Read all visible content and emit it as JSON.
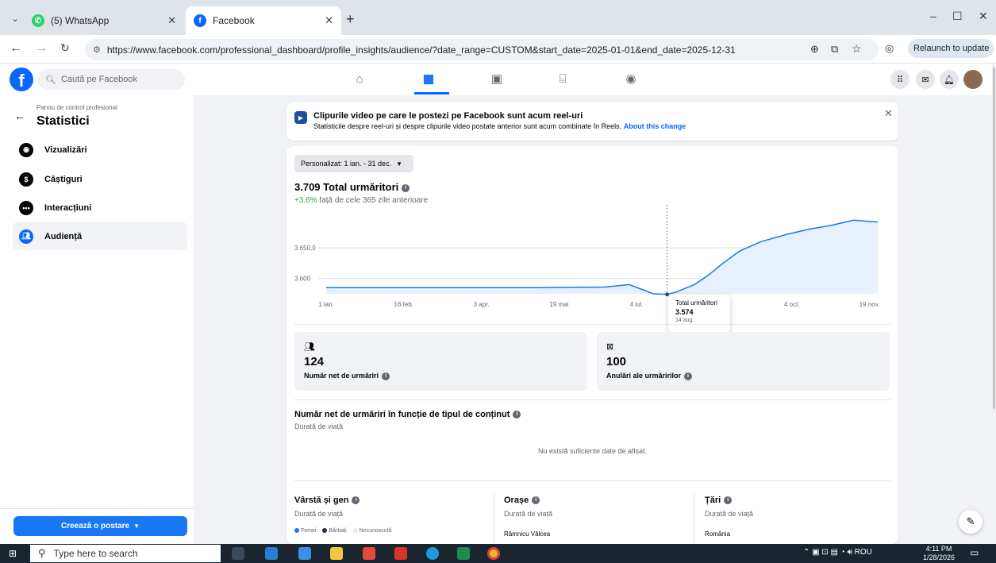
{
  "browser": {
    "tabs": [
      {
        "title": "(5) WhatsApp",
        "favicon": "whatsapp-icon"
      },
      {
        "title": "Facebook",
        "favicon": "facebook-icon"
      }
    ],
    "url": "https://www.facebook.com/professional_dashboard/profile_insights/audience/?date_range=CUSTOM&start_date=2025-01-01&end_date=2025-12-31",
    "relaunch_label": "Relaunch to update"
  },
  "fb": {
    "search_placeholder": "Caută pe Facebook",
    "logo_letter": "f"
  },
  "sidebar": {
    "subtitle": "Panou de control profesional",
    "title": "Statistici",
    "items": [
      {
        "label": "Vizualizări",
        "icon": "eye-icon"
      },
      {
        "label": "Câștiguri",
        "icon": "dollar-icon"
      },
      {
        "label": "Interacțiuni",
        "icon": "chat-icon"
      },
      {
        "label": "Audiență",
        "icon": "audience-icon"
      }
    ],
    "create_post": "Creează o postare"
  },
  "banner": {
    "title": "Clipurile video pe care le postezi pe Facebook sunt acum reel-uri",
    "text": "Statisticile despre reel-uri și despre clipurile video postate anterior sunt acum combinate în Reels.",
    "link": "About this change"
  },
  "insights": {
    "date_range": "Personalizat: 1 ian. - 31 dec.",
    "total": "3.709 Total urmăritori",
    "change_pct": "+3.6%",
    "change_text": "față de cele 365 zile anterioare",
    "tooltip": {
      "label": "Total urmăritori",
      "value": "3.574",
      "date": "14 aug."
    },
    "stats": [
      {
        "value": "124",
        "label": "Număr net de urmăriri",
        "icon": "people-icon"
      },
      {
        "value": "100",
        "label": "Anulări ale urmăririlor",
        "icon": "unfollow-icon"
      }
    ],
    "net_title": "Număr net de urmăriri în funcție de tipul de conținut",
    "net_sub": "Durată de viață",
    "net_empty": "Nu există suficiente date de afișat.",
    "sections": [
      {
        "title": "Vârstă și gen",
        "sub": "Durată de viață"
      },
      {
        "title": "Orașe",
        "sub": "Durată de viață"
      },
      {
        "title": "Țări",
        "sub": "Durată de viață"
      }
    ],
    "legend": [
      "Femei",
      "Bărbați",
      "Necunoscută"
    ],
    "city_first": "Râmnicu Vâlcea",
    "country_first": "România"
  },
  "chart_data": {
    "type": "area",
    "x": [
      "2025-01-01",
      "2025-02-16",
      "2025-04-03",
      "2025-05-19",
      "2025-07-04",
      "2025-07-20",
      "2025-08-05",
      "2025-08-14",
      "2025-08-20",
      "2025-09-01",
      "2025-09-10",
      "2025-09-20",
      "2025-10-01",
      "2025-10-15",
      "2025-11-01",
      "2025-11-15",
      "2025-12-01",
      "2025-12-15",
      "2025-12-31"
    ],
    "values": [
      3585,
      3585,
      3585,
      3585,
      3586,
      3590,
      3575,
      3574,
      3578,
      3590,
      3605,
      3625,
      3645,
      3660,
      3672,
      3680,
      3687,
      3695,
      3692
    ],
    "tick_labels": [
      "1 ian.",
      "16 feb.",
      "3 apr.",
      "19 mai",
      "4 iul.",
      "19 aug.",
      "4 oct.",
      "19 nov."
    ],
    "y_ticks": [
      3600,
      3650
    ],
    "y_tick_labels": [
      "3.600",
      "3.650,0"
    ],
    "ylim": [
      3575,
      3720
    ],
    "highlight": {
      "x": "2025-08-14",
      "y": 3574
    },
    "colors": {
      "line": "#1877f2",
      "fill": "#e7f0fd"
    }
  },
  "taskbar": {
    "search_placeholder": "Type here to search",
    "lang": "ROU",
    "time": "4:11 PM",
    "date": "1/28/2026"
  }
}
